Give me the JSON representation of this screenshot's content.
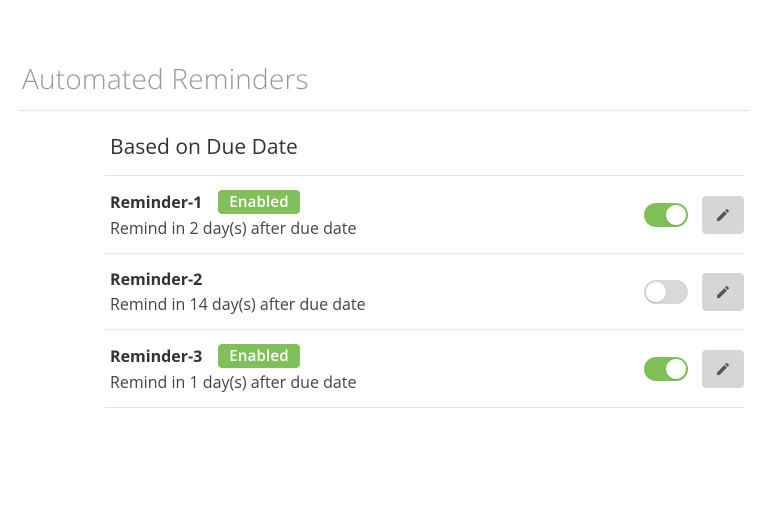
{
  "page": {
    "title": "Automated Reminders"
  },
  "section": {
    "title": "Based on Due Date"
  },
  "badge": {
    "enabled_label": "Enabled"
  },
  "reminders": [
    {
      "name": "Reminder-1",
      "enabled": true,
      "description": "Remind in 2 day(s) after due date"
    },
    {
      "name": "Reminder-2",
      "enabled": false,
      "description": "Remind in 14 day(s) after due date"
    },
    {
      "name": "Reminder-3",
      "enabled": true,
      "description": "Remind in 1 day(s) after due date"
    }
  ]
}
